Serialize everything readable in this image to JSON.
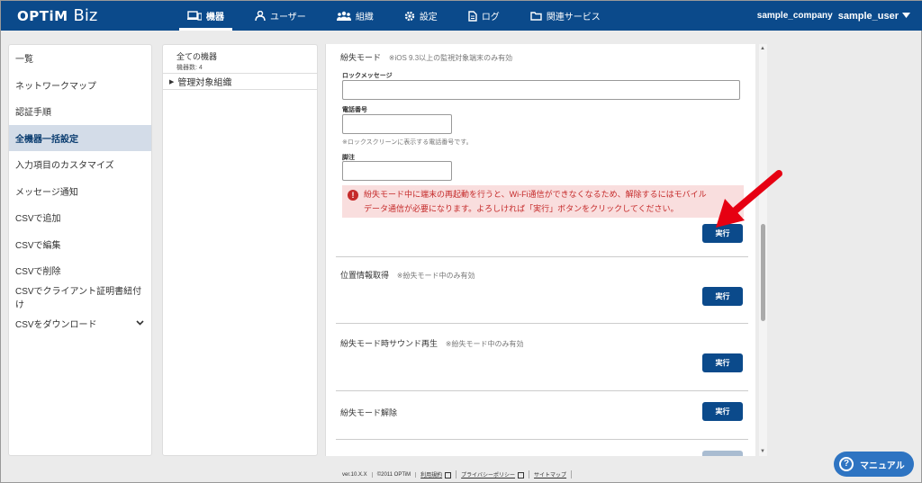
{
  "header": {
    "logo_main": "OPTiM",
    "logo_sub": "Biz",
    "nav": [
      {
        "label": "機器",
        "icon": "device-icon",
        "active": true
      },
      {
        "label": "ユーザー",
        "icon": "user-icon"
      },
      {
        "label": "組織",
        "icon": "organization-icon"
      },
      {
        "label": "設定",
        "icon": "gear-icon"
      },
      {
        "label": "ログ",
        "icon": "log-icon"
      },
      {
        "label": "関連サービス",
        "icon": "folder-icon"
      }
    ],
    "company": "sample_company",
    "username": "sample_user"
  },
  "left_menu": {
    "items": [
      {
        "label": "一覧"
      },
      {
        "label": "ネットワークマップ"
      },
      {
        "label": "認証手順"
      },
      {
        "label": "全機器一括設定",
        "active": true
      },
      {
        "label": "入力項目のカスタマイズ"
      },
      {
        "label": "メッセージ通知"
      },
      {
        "label": "CSVで追加"
      },
      {
        "label": "CSVで編集"
      },
      {
        "label": "CSVで削除"
      },
      {
        "label": "CSVでクライアント証明書紐付け"
      },
      {
        "label": "CSVをダウンロード"
      }
    ]
  },
  "tree": {
    "all_title": "全ての機器",
    "all_count": "機器数: 4",
    "node_caret": "▶",
    "node_label": "管理対象組織"
  },
  "lost_mode": {
    "title": "紛失モード",
    "note": "※iOS 9.3以上の監視対象端末のみ有効",
    "lock_message_label": "ロックメッセージ",
    "lock_message_value": "",
    "phone_label": "電話番号",
    "phone_value": "",
    "phone_help": "※ロックスクリーンに表示する電話番号です。",
    "footnote_label": "脚注",
    "footnote_value": "",
    "warning_line1": "紛失モード中に端末の再起動を行うと、Wi-Fi通信ができなくなるため、解除するにはモバイル",
    "warning_line2": "データ通信が必要になります。よろしければ「実行」ボタンをクリックしてください。",
    "execute_label": "実行"
  },
  "location": {
    "title": "位置情報取得",
    "note": "※紛失モード中のみ有効",
    "execute_label": "実行"
  },
  "sound": {
    "title": "紛失モード時サウンド再生",
    "note": "※紛失モード中のみ有効",
    "execute_label": "実行"
  },
  "release": {
    "title": "紛失モード解除",
    "execute_label": "実行"
  },
  "footer": {
    "version": "ver.10.X.X",
    "copyright": "©2011 OPTiM",
    "terms": "利用規約",
    "privacy": "プライバシーポリシー",
    "sitemap": "サイトマップ"
  },
  "manual_button": {
    "label": "マニュアル",
    "icon": "question-icon"
  },
  "colors": {
    "brand": "#0b4a8b",
    "warning_bg": "#f9dede",
    "warning_text": "#c52a2a",
    "annotation_arrow": "#e60012"
  }
}
